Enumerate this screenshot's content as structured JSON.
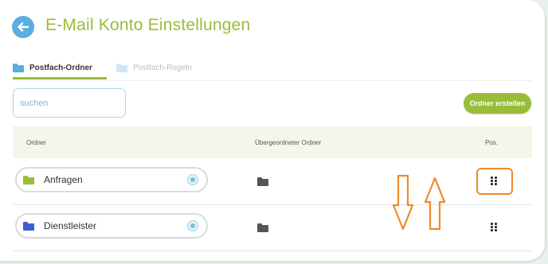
{
  "header": {
    "title": "E-Mail Konto Einstellungen",
    "back_icon": "arrow-left-icon"
  },
  "tabs": [
    {
      "label": "Postfach-Ordner",
      "active": true
    },
    {
      "label": "Postfach-Regeln",
      "active": false
    }
  ],
  "search": {
    "placeholder": "suchen"
  },
  "actions": {
    "create_label": "Ordner erstellen"
  },
  "table": {
    "headers": {
      "folder": "Ordner",
      "parent": "Übergeordneter Ordner",
      "position": "Pos."
    },
    "rows": [
      {
        "name": "Anfragen",
        "folder_color": "#98bd3a",
        "highlighted": true
      },
      {
        "name": "Dienstleister",
        "folder_color": "#3f5fd6",
        "highlighted": false
      }
    ]
  },
  "colors": {
    "accent": "#98bd3a",
    "back_button": "#5aaee0",
    "annotation": "#f08a24"
  },
  "annotations": {
    "reorder_arrows": "up-down-arrows-icon"
  }
}
